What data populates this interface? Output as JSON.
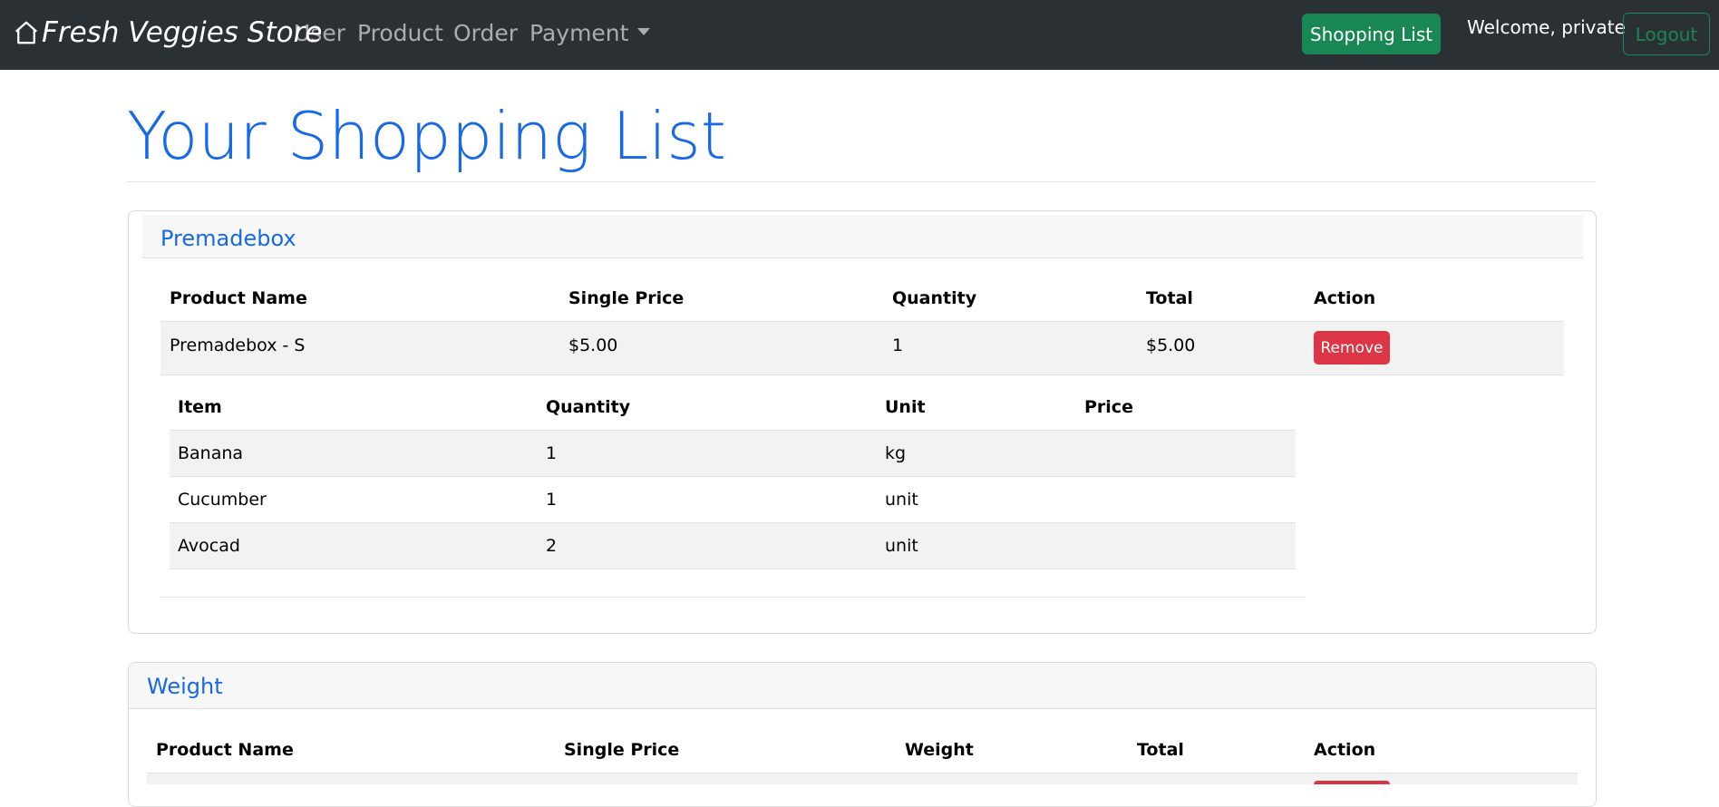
{
  "navbar": {
    "brand": "Fresh Veggies Store",
    "links": [
      "User",
      "Product",
      "Order",
      "Payment"
    ],
    "shopping_list_button": "Shopping List",
    "welcome": "Welcome, private",
    "logout_button": "Logout"
  },
  "page": {
    "title": "Your Shopping List"
  },
  "premadebox": {
    "title": "Premadebox",
    "headers": [
      "Product Name",
      "Single Price",
      "Quantity",
      "Total",
      "Action"
    ],
    "row": {
      "name": "Premadebox - S",
      "price": "$5.00",
      "quantity": "1",
      "total": "$5.00",
      "action": "Remove"
    },
    "items_headers": [
      "Item",
      "Quantity",
      "Unit",
      "Price"
    ],
    "items": [
      {
        "item": "Banana",
        "quantity": "1",
        "unit": "kg",
        "price": ""
      },
      {
        "item": "Cucumber",
        "quantity": "1",
        "unit": "unit",
        "price": ""
      },
      {
        "item": "Avocad",
        "quantity": "2",
        "unit": "unit",
        "price": ""
      }
    ]
  },
  "weight": {
    "title": "Weight",
    "headers": [
      "Product Name",
      "Single Price",
      "Weight",
      "Total",
      "Action"
    ]
  },
  "colors": {
    "navbar": "#2b3035",
    "primary": "#1769e8",
    "success": "#198754",
    "danger": "#dc3545"
  }
}
